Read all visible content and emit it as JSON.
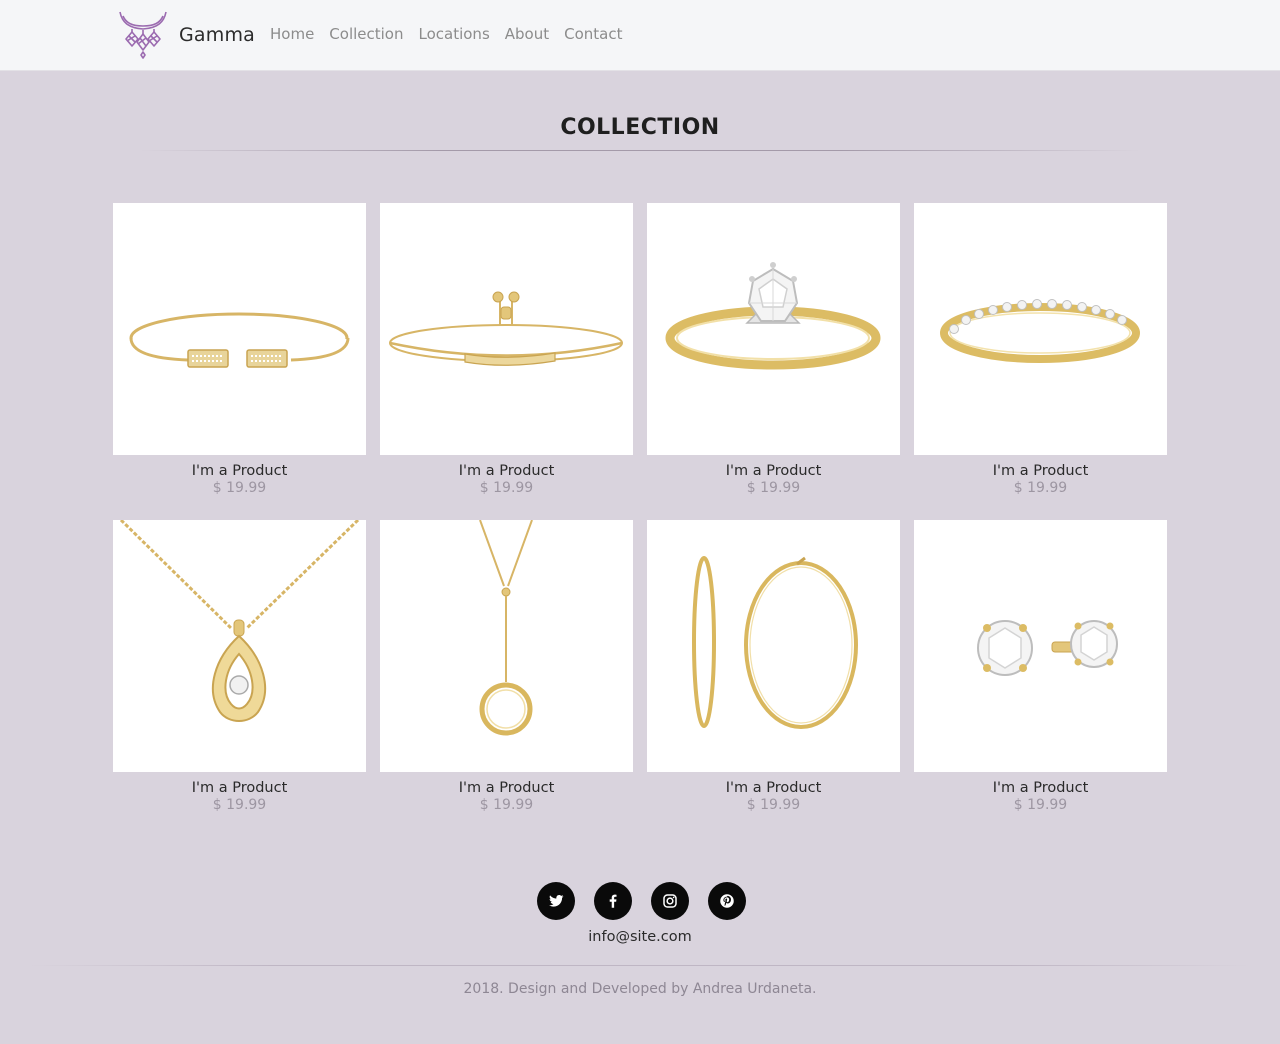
{
  "brand": {
    "name": "Gamma",
    "logo_icon": "necklace-icon",
    "logo_color": "#9b6bb0"
  },
  "nav": {
    "items": [
      {
        "label": "Home"
      },
      {
        "label": "Collection"
      },
      {
        "label": "Locations"
      },
      {
        "label": "About"
      },
      {
        "label": "Contact"
      }
    ]
  },
  "section": {
    "title": "COLLECTION"
  },
  "products": [
    {
      "name": "I'm a Product",
      "price": "$ 19.99",
      "image": "cuff-bracelet-icon"
    },
    {
      "name": "I'm a Product",
      "price": "$ 19.99",
      "image": "chain-bracelet-icon"
    },
    {
      "name": "I'm a Product",
      "price": "$ 19.99",
      "image": "solitaire-ring-icon"
    },
    {
      "name": "I'm a Product",
      "price": "$ 19.99",
      "image": "eternity-band-icon"
    },
    {
      "name": "I'm a Product",
      "price": "$ 19.99",
      "image": "pendant-necklace-icon"
    },
    {
      "name": "I'm a Product",
      "price": "$ 19.99",
      "image": "circle-lariat-necklace-icon"
    },
    {
      "name": "I'm a Product",
      "price": "$ 19.99",
      "image": "hoop-earrings-icon"
    },
    {
      "name": "I'm a Product",
      "price": "$ 19.99",
      "image": "stud-earrings-icon"
    }
  ],
  "footer": {
    "socials": [
      {
        "icon": "twitter-icon"
      },
      {
        "icon": "facebook-icon"
      },
      {
        "icon": "instagram-icon"
      },
      {
        "icon": "pinterest-icon"
      }
    ],
    "email": "info@site.com",
    "credit": "2018. Design and Developed by Andrea Urdaneta."
  },
  "colors": {
    "background": "#d9d3dd",
    "navbar": "#f5f6f8",
    "gold": "#d9b75e",
    "price": "#9d96a2"
  }
}
